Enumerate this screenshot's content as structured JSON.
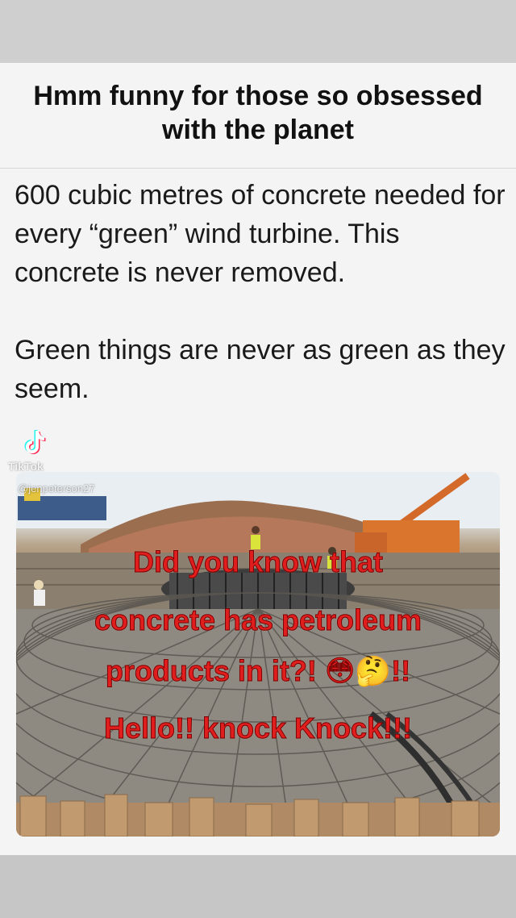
{
  "post": {
    "title_line1": "Hmm funny for those so obsessed",
    "title_line2": "with the planet",
    "paragraph1": "600 cubic metres of concrete needed for every “green” wind turbine. This concrete is never removed.",
    "paragraph2": "Green things are never as green as they seem."
  },
  "watermark": {
    "brand": "TikTok",
    "handle": "@jenpeterson27"
  },
  "overlay": {
    "line1": "Did you know that",
    "line2": "concrete has petroleum",
    "line3": "products in it?! 😳🤔!!",
    "line4": "Hello!! knock Knock!!!"
  },
  "colors": {
    "overlay_text": "#e01e1e",
    "background": "#f4f4f4"
  },
  "icons": {
    "watermark": "tiktok-logo-icon"
  }
}
